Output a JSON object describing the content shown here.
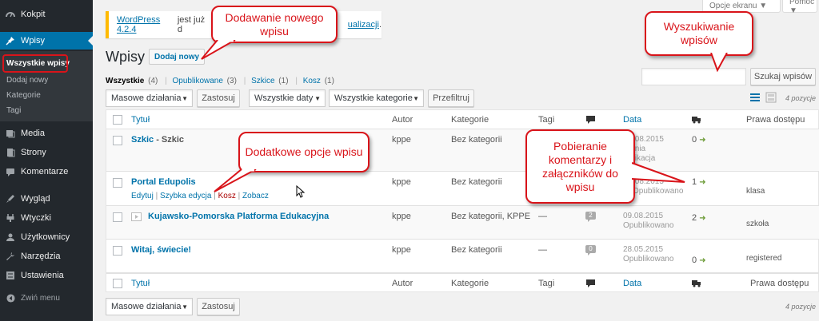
{
  "sidebar": {
    "items": [
      {
        "label": "Kokpit",
        "icon": "dashboard-icon"
      },
      {
        "label": "Wpisy",
        "icon": "pin-icon"
      },
      {
        "label": "Media",
        "icon": "media-icon"
      },
      {
        "label": "Strony",
        "icon": "pages-icon"
      },
      {
        "label": "Komentarze",
        "icon": "comments-icon"
      },
      {
        "label": "Wygląd",
        "icon": "appearance-icon"
      },
      {
        "label": "Wtyczki",
        "icon": "plugins-icon"
      },
      {
        "label": "Użytkownicy",
        "icon": "users-icon"
      },
      {
        "label": "Narzędzia",
        "icon": "tools-icon"
      },
      {
        "label": "Ustawienia",
        "icon": "settings-icon"
      },
      {
        "label": "Zwiń menu",
        "icon": "collapse-icon"
      }
    ],
    "submenu": [
      "Wszystkie wpisy",
      "Dodaj nowy",
      "Kategorie",
      "Tagi"
    ]
  },
  "top": {
    "screen_options": "Opcje ekranu ▼",
    "help": "Pomoc ▼",
    "notice_link": "WordPress 4.2.4",
    "notice_text": " jest już d",
    "notice_tail": "ualizacji",
    "notice_end": "."
  },
  "page": {
    "title": "Wpisy",
    "add_new": "Dodaj nowy"
  },
  "filters": {
    "all": "Wszystkie",
    "all_count": " (4)",
    "published": "Opublikowane",
    "published_count": " (3)",
    "drafts": "Szkice",
    "drafts_count": " (1)",
    "trash": "Kosz",
    "trash_count": " (1)",
    "sep": "|"
  },
  "controls": {
    "bulk": "Masowe działania",
    "apply": "Zastosuj",
    "dates": "Wszystkie daty",
    "categories": "Wszystkie kategorie",
    "filter": "Przefiltruj",
    "search_button": "Szukaj wpisów",
    "count": "4 pozycje"
  },
  "table": {
    "headers": {
      "title": "Tytuł",
      "author": "Autor",
      "categories": "Kategorie",
      "tags": "Tagi",
      "date": "Data",
      "access": "Prawa dostępu"
    },
    "rows": [
      {
        "title": "Szkic",
        "suffix": " - Szkic",
        "author": "kppe",
        "categories": "Bez kategorii",
        "tags": "",
        "comments": "",
        "date_line1": ".08.2015",
        "date_line2": "tnia",
        "date_line3": "fikacja",
        "downloads": "0",
        "access": ""
      },
      {
        "title": "Portal Edupolis",
        "suffix": "",
        "author": "kppe",
        "categories": "Bez kategorii",
        "tags": "",
        "comments": "",
        "date_line1": ".08.2015",
        "date_line2": "Opublikowano",
        "date_line3": "",
        "downloads": "1",
        "access": "klasa"
      },
      {
        "title": "Kujawsko-Pomorska Platforma Edukacyjna",
        "suffix": "",
        "author": "kppe",
        "categories": "Bez kategorii, KPPE",
        "tags": "—",
        "comments": "2",
        "date_line1": "09.08.2015",
        "date_line2": "Opublikowano",
        "date_line3": "",
        "downloads": "2",
        "access": "szkoła"
      },
      {
        "title": "Witaj, świecie!",
        "suffix": "",
        "author": "kppe",
        "categories": "Bez kategorii",
        "tags": "—",
        "comments": "0",
        "date_line1": "28.05.2015",
        "date_line2": "Opublikowano",
        "date_line3": "",
        "downloads": "0",
        "access": "registered"
      }
    ],
    "row_actions": {
      "edit": "Edytuj",
      "quick": "Szybka edycja",
      "trash": "Kosz",
      "view": "Zobacz",
      "sep": "|"
    }
  },
  "callouts": {
    "add_new": "Dodawanie nowego wpisu",
    "search": "Wyszukiwanie wpisów",
    "options": "Dodatkowe opcje wpisu",
    "attachments": "Pobieranie komentarzy i załączników do wpisu"
  },
  "colors": {
    "accent": "#0073aa",
    "sidebar": "#23282d",
    "callout": "#d9141a",
    "download": "#6a9a34"
  }
}
